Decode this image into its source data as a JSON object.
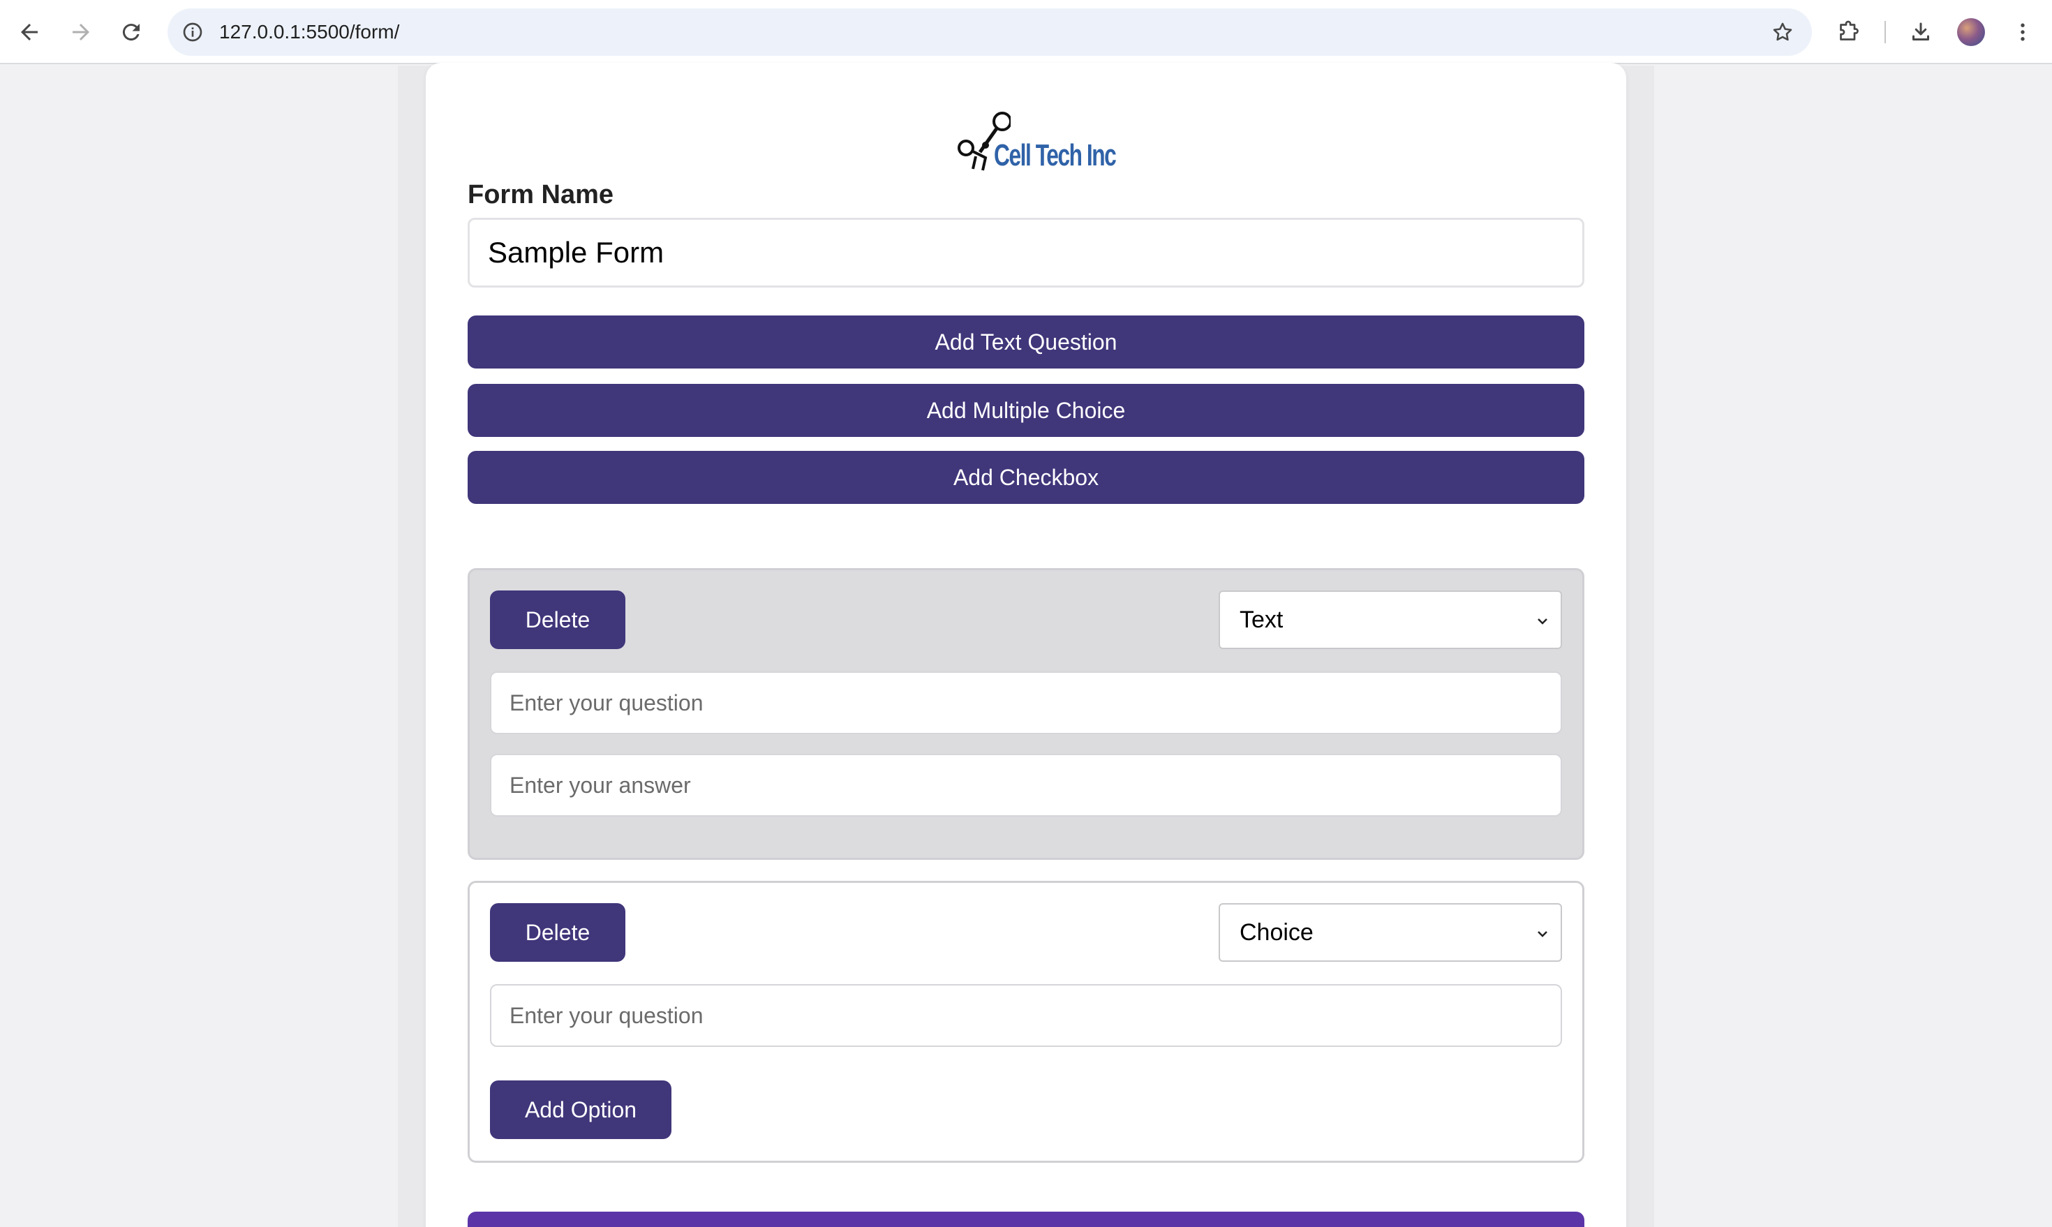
{
  "browser": {
    "url": "127.0.0.1:5500/form/"
  },
  "logo": {
    "text": "Cell Tech Inc"
  },
  "form": {
    "name_label": "Form Name",
    "name_value": "Sample Form",
    "add_text_label": "Add Text Question",
    "add_multiple_label": "Add Multiple Choice",
    "add_checkbox_label": "Add Checkbox"
  },
  "questions": [
    {
      "delete_label": "Delete",
      "type": "Text",
      "question_placeholder": "Enter your question",
      "answer_placeholder": "Enter your answer"
    },
    {
      "delete_label": "Delete",
      "type": "Choice",
      "question_placeholder": "Enter your question",
      "add_option_label": "Add Option"
    }
  ],
  "colors": {
    "primary_button": "#40367a",
    "submit_button": "#5b35a8"
  }
}
